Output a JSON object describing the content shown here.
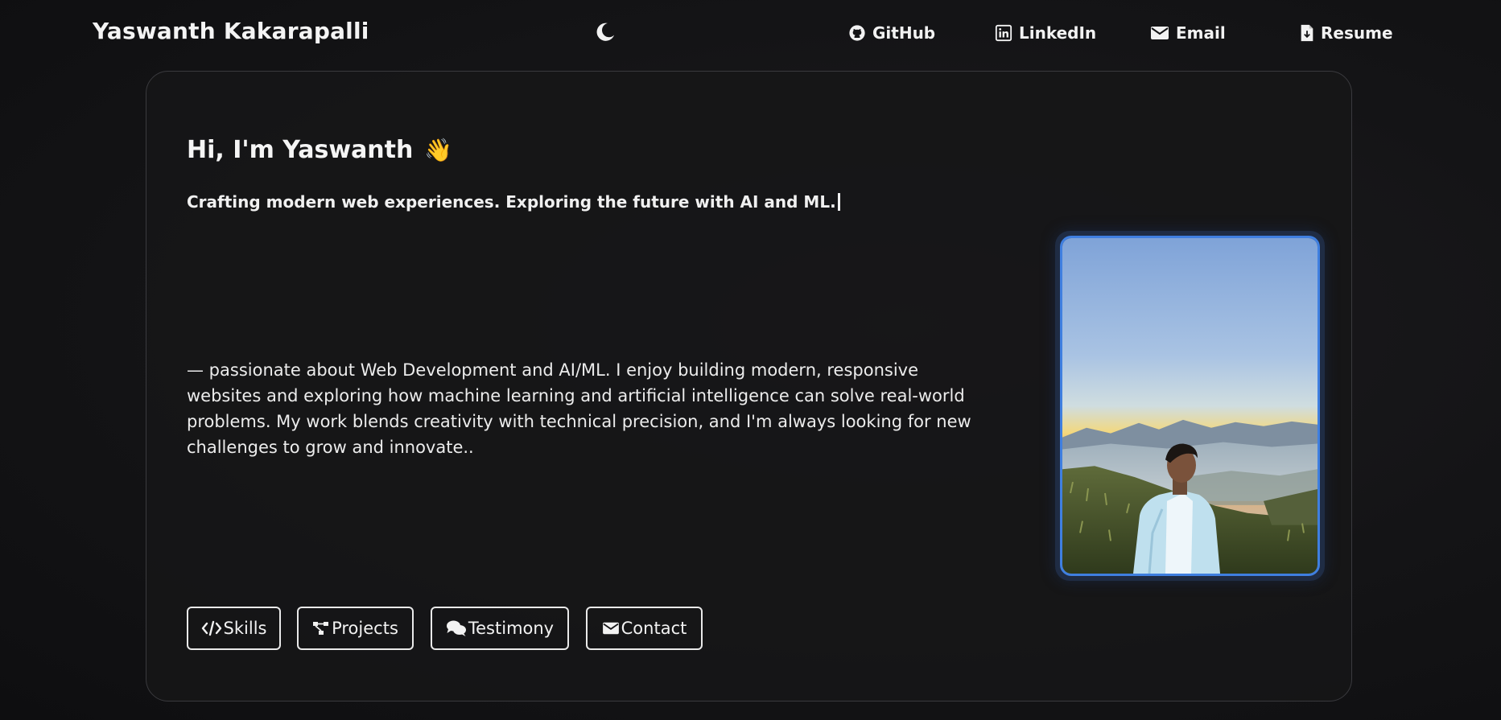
{
  "header": {
    "site_title": "Yaswanth Kakarapalli",
    "theme_toggle_icon": "moon-icon",
    "nav": [
      {
        "label": "GitHub",
        "icon": "github-icon"
      },
      {
        "label": "LinkedIn",
        "icon": "linkedin-icon"
      },
      {
        "label": "Email",
        "icon": "envelope-icon"
      },
      {
        "label": "Resume",
        "icon": "file-download-icon"
      }
    ]
  },
  "hero": {
    "greeting": "Hi, I'm Yaswanth",
    "wave_emoji": "👋",
    "tagline": "Crafting modern web experiences. Exploring the future with AI and ML.",
    "bio": "— passionate about Web Development and AI/ML. I enjoy building modern, responsive websites and exploring how machine learning and artificial intelligence can solve real-world problems. My work blends creativity with technical precision, and I'm always looking for new challenges to grow and innovate..",
    "buttons": [
      {
        "label": "Skills",
        "icon": "code-icon"
      },
      {
        "label": "Projects",
        "icon": "project-diagram-icon"
      },
      {
        "label": "Testimony",
        "icon": "comments-icon"
      },
      {
        "label": "Contact",
        "icon": "envelope-icon"
      }
    ]
  },
  "colors": {
    "background": "#141416",
    "card_border": "#3a3a3e",
    "photo_border": "#3f7fe0",
    "text": "#f2f2f2"
  }
}
